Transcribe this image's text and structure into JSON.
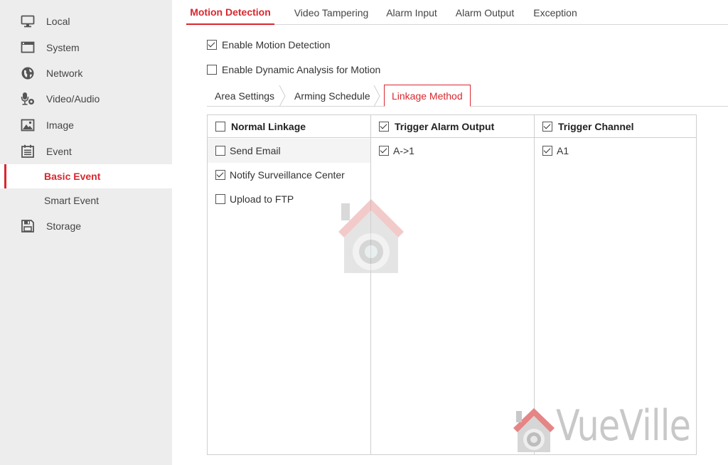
{
  "sidebar": {
    "items": [
      {
        "label": "Local",
        "icon": "monitor-icon"
      },
      {
        "label": "System",
        "icon": "window-icon"
      },
      {
        "label": "Network",
        "icon": "globe-icon"
      },
      {
        "label": "Video/Audio",
        "icon": "microphone-camera-icon"
      },
      {
        "label": "Image",
        "icon": "image-icon"
      },
      {
        "label": "Event",
        "icon": "calendar-list-icon"
      },
      {
        "label": "Storage",
        "icon": "floppy-disk-icon"
      }
    ],
    "event_subitems": [
      {
        "label": "Basic Event",
        "active": true
      },
      {
        "label": "Smart Event",
        "active": false
      }
    ]
  },
  "top_tabs": [
    {
      "label": "Motion Detection",
      "active": true
    },
    {
      "label": "Video Tampering",
      "active": false
    },
    {
      "label": "Alarm Input",
      "active": false
    },
    {
      "label": "Alarm Output",
      "active": false
    },
    {
      "label": "Exception",
      "active": false
    }
  ],
  "options": {
    "enable_motion": {
      "label": "Enable Motion Detection",
      "checked": true
    },
    "enable_dynamic": {
      "label": "Enable Dynamic Analysis for Motion",
      "checked": false
    }
  },
  "sub_tabs": [
    {
      "label": "Area Settings",
      "active": false
    },
    {
      "label": "Arming Schedule",
      "active": false
    },
    {
      "label": "Linkage Method",
      "active": true
    }
  ],
  "linkage": {
    "normal": {
      "header": "Normal Linkage",
      "checked": false,
      "items": [
        {
          "label": "Send Email",
          "checked": false
        },
        {
          "label": "Notify Surveillance Center",
          "checked": true
        },
        {
          "label": "Upload to FTP",
          "checked": false
        }
      ]
    },
    "alarm_output": {
      "header": "Trigger Alarm Output",
      "checked": true,
      "items": [
        {
          "label": "A->1",
          "checked": true
        }
      ]
    },
    "channel": {
      "header": "Trigger Channel",
      "checked": true,
      "items": [
        {
          "label": "A1",
          "checked": true
        }
      ]
    }
  },
  "watermark": {
    "text": "VueVille"
  },
  "colors": {
    "accent": "#d9272e",
    "sidebar_bg": "#ededed",
    "border": "#cfcfcf"
  }
}
